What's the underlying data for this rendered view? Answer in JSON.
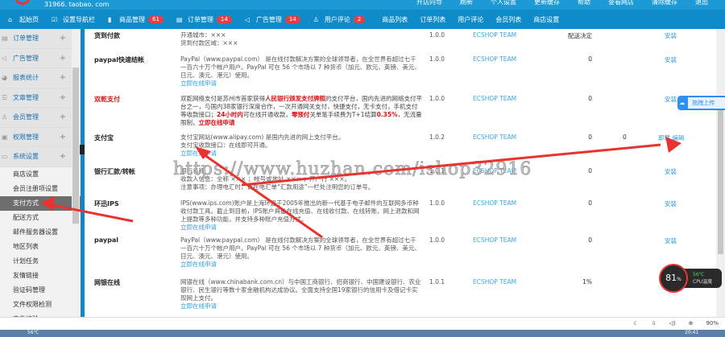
{
  "header": {
    "logo_text": "31966. taobao. com",
    "top_links": [
      "开店向导",
      "刷新",
      "个人设置",
      "更新缓存",
      "帮助",
      "查看网店",
      "清除缓存",
      "退出"
    ]
  },
  "nav": {
    "items": [
      {
        "label": "起始页"
      },
      {
        "label": "设置导航栏"
      },
      {
        "label": "商品管理",
        "badge": "61"
      },
      {
        "label": "订单管理",
        "badge": "14"
      },
      {
        "label": "广告管理",
        "badge": "14"
      },
      {
        "label": "用户评论",
        "badge": "2"
      }
    ],
    "plain": [
      "商品列表",
      "订单列表",
      "用户评论",
      "会员列表",
      "商店设置"
    ]
  },
  "sidebar": {
    "groups": [
      "订单管理",
      "广告管理",
      "报表统计",
      "文章管理",
      "会员管理",
      "权限管理",
      "系统设置"
    ],
    "subitems": [
      "商店设置",
      "会员注册项设置",
      "支付方式",
      "配送方式",
      "邮件服务器设置",
      "地区列表",
      "计划任务",
      "友情链接",
      "验证码管理",
      "文件权限检测",
      "文件校验"
    ],
    "active": "支付方式"
  },
  "payments": [
    {
      "name": "货到付款",
      "desc": [
        "开通城市：×××",
        "货到付款区域：×××"
      ],
      "version": "1.0.0",
      "author": "ECSHOP TEAM",
      "fee": "配送决定",
      "order": "",
      "action": "安装"
    },
    {
      "name": "paypal快速结帐",
      "desc": [
        "PayPal（www.paypal.com） 是在线付款解决方案的全球领导者，在全世界有超过七千一百六十万个帐户用户。PayPal 可在 56 个市场以 7 种货币（加元、欧元、英镑、美元、日元、澳元、港元）使用。"
      ],
      "link": "立即在线申请",
      "version": "1.0.0",
      "author": "ECSHOP TEAM",
      "fee": "0",
      "order": "",
      "action": "安装"
    },
    {
      "name": "双乾支付",
      "desc_parts": [
        "双乾网络支付是苏州市首家获得",
        "人民银行颁发支付牌照",
        "的支付平台，国内先进的网络支付平台之一，与国内38家银行深度合作，一次开通网关支付，快捷支付，无卡支付，手机支付等收款接口；",
        "24小时内",
        "可在线开通收款，",
        "零预付",
        "关单笔手续费为T+1结算",
        "0.35%",
        "，无流量限制，",
        "立即在线申请"
      ],
      "version": "1.0.0",
      "author": "ECSHOP TEAM",
      "fee": "0",
      "order": "",
      "action": "安装"
    },
    {
      "name": "支付宝",
      "desc": [
        "支付宝网站(www.alipay.com) 是国内先进的网上支付平台。",
        "支付宝收款接口：在线即可开通。"
      ],
      "link": "立即在线申请",
      "version": "1.0.2",
      "author": "ECSHOP TEAM",
      "fee": "0",
      "order": "0",
      "action": "卸载 编辑"
    },
    {
      "name": "银行汇款/转帐",
      "desc": [
        "银行名称",
        "收款人信息：全称 ××× ；帐号或地址 ××× ；开户行 ×××。",
        "注意事项：办理电汇时，请在电汇单“汇款用途”一栏处注明您的订单号。"
      ],
      "version": "1.0.1",
      "author": "ECSHOP TEAM",
      "fee": "0",
      "order": "",
      "action": "安装"
    },
    {
      "name": "环迅IPS",
      "desc": [
        "IPS(www.ips.com)账户是上海环迅于2005年推出的新一代基于电子邮件的互联网多币种收付款工具。截止到目前，IPS账户具备在线充值、在线收付款、在线转账、网上退款和网上提款等多种功能，并支持多种账户充值方式。"
      ],
      "link": "立即在线申请",
      "version": "1.0.0",
      "author": "ECSHOP TEAM",
      "fee": "0",
      "order": "",
      "action": "安装"
    },
    {
      "name": "paypal",
      "desc": [
        "PayPal（www.paypal.com） 是在线付款解决方案的全球领导者，在全世界有超过七千一百六十万个帐户用户。PayPal 可在 56 个市场以 7 种货币（加元、欧元、英镑、美元、日元、澳元、港元）使用。"
      ],
      "link": "立即在线申请",
      "version": "1.0.0",
      "author": "ECSHOP TEAM",
      "fee": "0",
      "order": "",
      "action": "安装"
    },
    {
      "name": "网银在线",
      "desc": [
        "网银在线（www.chinabank.com.cn）与中国工商银行、招商银行、中国建设银行、农业银行、民生银行等数十家金融机构达成协议。全面支持全国19家银行的信用卡及借记卡实现网上支付。"
      ],
      "link": "立即在线申请",
      "version": "1.0.1",
      "author": "ECSHOP TEAM",
      "fee": "1%",
      "order": "",
      "action": ""
    }
  ],
  "watermark": "https://www.huzhan.com/ishop32916",
  "cloud_widget": {
    "label": "拖拽上传"
  },
  "cpu_widget": {
    "percent": "81",
    "unit": "%",
    "temp": "56℃",
    "label": "CPU温度"
  },
  "statusbar": {
    "zoom": "90%"
  },
  "taskbar": {
    "temp": "56℃",
    "time": "20:41"
  }
}
